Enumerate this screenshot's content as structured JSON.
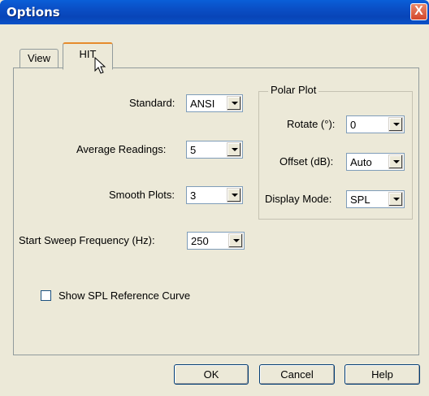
{
  "window": {
    "title": "Options",
    "close_glyph": "X"
  },
  "tabs": [
    {
      "label": "View",
      "selected": false
    },
    {
      "label": "HIT",
      "selected": true
    }
  ],
  "hit": {
    "standard": {
      "label": "Standard:",
      "value": "ANSI"
    },
    "average_readings": {
      "label": "Average Readings:",
      "value": "5"
    },
    "smooth_plots": {
      "label": "Smooth Plots:",
      "value": "3"
    },
    "start_sweep": {
      "label": "Start Sweep Frequency (Hz):",
      "value": "250"
    },
    "polar_plot": {
      "title": "Polar Plot",
      "rotate": {
        "label": "Rotate (°):",
        "value": "0"
      },
      "offset": {
        "label": "Offset (dB):",
        "value": "Auto"
      },
      "display_mode": {
        "label": "Display Mode:",
        "value": "SPL"
      }
    },
    "show_spl_reference": {
      "label": "Show SPL Reference Curve",
      "checked": false
    }
  },
  "buttons": {
    "ok": "OK",
    "cancel": "Cancel",
    "help": "Help"
  }
}
